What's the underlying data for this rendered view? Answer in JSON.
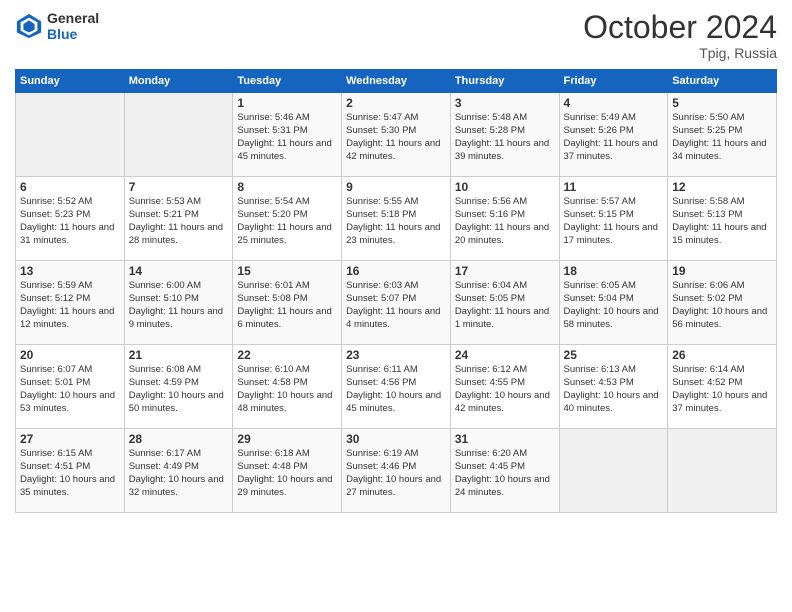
{
  "header": {
    "logo_line1": "General",
    "logo_line2": "Blue",
    "month": "October 2024",
    "location": "Tpig, Russia"
  },
  "weekdays": [
    "Sunday",
    "Monday",
    "Tuesday",
    "Wednesday",
    "Thursday",
    "Friday",
    "Saturday"
  ],
  "weeks": [
    [
      {
        "day": "",
        "sunrise": "",
        "sunset": "",
        "daylight": "",
        "empty": true
      },
      {
        "day": "",
        "sunrise": "",
        "sunset": "",
        "daylight": "",
        "empty": true
      },
      {
        "day": "1",
        "sunrise": "Sunrise: 5:46 AM",
        "sunset": "Sunset: 5:31 PM",
        "daylight": "Daylight: 11 hours and 45 minutes."
      },
      {
        "day": "2",
        "sunrise": "Sunrise: 5:47 AM",
        "sunset": "Sunset: 5:30 PM",
        "daylight": "Daylight: 11 hours and 42 minutes."
      },
      {
        "day": "3",
        "sunrise": "Sunrise: 5:48 AM",
        "sunset": "Sunset: 5:28 PM",
        "daylight": "Daylight: 11 hours and 39 minutes."
      },
      {
        "day": "4",
        "sunrise": "Sunrise: 5:49 AM",
        "sunset": "Sunset: 5:26 PM",
        "daylight": "Daylight: 11 hours and 37 minutes."
      },
      {
        "day": "5",
        "sunrise": "Sunrise: 5:50 AM",
        "sunset": "Sunset: 5:25 PM",
        "daylight": "Daylight: 11 hours and 34 minutes."
      }
    ],
    [
      {
        "day": "6",
        "sunrise": "Sunrise: 5:52 AM",
        "sunset": "Sunset: 5:23 PM",
        "daylight": "Daylight: 11 hours and 31 minutes."
      },
      {
        "day": "7",
        "sunrise": "Sunrise: 5:53 AM",
        "sunset": "Sunset: 5:21 PM",
        "daylight": "Daylight: 11 hours and 28 minutes."
      },
      {
        "day": "8",
        "sunrise": "Sunrise: 5:54 AM",
        "sunset": "Sunset: 5:20 PM",
        "daylight": "Daylight: 11 hours and 25 minutes."
      },
      {
        "day": "9",
        "sunrise": "Sunrise: 5:55 AM",
        "sunset": "Sunset: 5:18 PM",
        "daylight": "Daylight: 11 hours and 23 minutes."
      },
      {
        "day": "10",
        "sunrise": "Sunrise: 5:56 AM",
        "sunset": "Sunset: 5:16 PM",
        "daylight": "Daylight: 11 hours and 20 minutes."
      },
      {
        "day": "11",
        "sunrise": "Sunrise: 5:57 AM",
        "sunset": "Sunset: 5:15 PM",
        "daylight": "Daylight: 11 hours and 17 minutes."
      },
      {
        "day": "12",
        "sunrise": "Sunrise: 5:58 AM",
        "sunset": "Sunset: 5:13 PM",
        "daylight": "Daylight: 11 hours and 15 minutes."
      }
    ],
    [
      {
        "day": "13",
        "sunrise": "Sunrise: 5:59 AM",
        "sunset": "Sunset: 5:12 PM",
        "daylight": "Daylight: 11 hours and 12 minutes."
      },
      {
        "day": "14",
        "sunrise": "Sunrise: 6:00 AM",
        "sunset": "Sunset: 5:10 PM",
        "daylight": "Daylight: 11 hours and 9 minutes."
      },
      {
        "day": "15",
        "sunrise": "Sunrise: 6:01 AM",
        "sunset": "Sunset: 5:08 PM",
        "daylight": "Daylight: 11 hours and 6 minutes."
      },
      {
        "day": "16",
        "sunrise": "Sunrise: 6:03 AM",
        "sunset": "Sunset: 5:07 PM",
        "daylight": "Daylight: 11 hours and 4 minutes."
      },
      {
        "day": "17",
        "sunrise": "Sunrise: 6:04 AM",
        "sunset": "Sunset: 5:05 PM",
        "daylight": "Daylight: 11 hours and 1 minute."
      },
      {
        "day": "18",
        "sunrise": "Sunrise: 6:05 AM",
        "sunset": "Sunset: 5:04 PM",
        "daylight": "Daylight: 10 hours and 58 minutes."
      },
      {
        "day": "19",
        "sunrise": "Sunrise: 6:06 AM",
        "sunset": "Sunset: 5:02 PM",
        "daylight": "Daylight: 10 hours and 56 minutes."
      }
    ],
    [
      {
        "day": "20",
        "sunrise": "Sunrise: 6:07 AM",
        "sunset": "Sunset: 5:01 PM",
        "daylight": "Daylight: 10 hours and 53 minutes."
      },
      {
        "day": "21",
        "sunrise": "Sunrise: 6:08 AM",
        "sunset": "Sunset: 4:59 PM",
        "daylight": "Daylight: 10 hours and 50 minutes."
      },
      {
        "day": "22",
        "sunrise": "Sunrise: 6:10 AM",
        "sunset": "Sunset: 4:58 PM",
        "daylight": "Daylight: 10 hours and 48 minutes."
      },
      {
        "day": "23",
        "sunrise": "Sunrise: 6:11 AM",
        "sunset": "Sunset: 4:56 PM",
        "daylight": "Daylight: 10 hours and 45 minutes."
      },
      {
        "day": "24",
        "sunrise": "Sunrise: 6:12 AM",
        "sunset": "Sunset: 4:55 PM",
        "daylight": "Daylight: 10 hours and 42 minutes."
      },
      {
        "day": "25",
        "sunrise": "Sunrise: 6:13 AM",
        "sunset": "Sunset: 4:53 PM",
        "daylight": "Daylight: 10 hours and 40 minutes."
      },
      {
        "day": "26",
        "sunrise": "Sunrise: 6:14 AM",
        "sunset": "Sunset: 4:52 PM",
        "daylight": "Daylight: 10 hours and 37 minutes."
      }
    ],
    [
      {
        "day": "27",
        "sunrise": "Sunrise: 6:15 AM",
        "sunset": "Sunset: 4:51 PM",
        "daylight": "Daylight: 10 hours and 35 minutes."
      },
      {
        "day": "28",
        "sunrise": "Sunrise: 6:17 AM",
        "sunset": "Sunset: 4:49 PM",
        "daylight": "Daylight: 10 hours and 32 minutes."
      },
      {
        "day": "29",
        "sunrise": "Sunrise: 6:18 AM",
        "sunset": "Sunset: 4:48 PM",
        "daylight": "Daylight: 10 hours and 29 minutes."
      },
      {
        "day": "30",
        "sunrise": "Sunrise: 6:19 AM",
        "sunset": "Sunset: 4:46 PM",
        "daylight": "Daylight: 10 hours and 27 minutes."
      },
      {
        "day": "31",
        "sunrise": "Sunrise: 6:20 AM",
        "sunset": "Sunset: 4:45 PM",
        "daylight": "Daylight: 10 hours and 24 minutes."
      },
      {
        "day": "",
        "sunrise": "",
        "sunset": "",
        "daylight": "",
        "empty": true
      },
      {
        "day": "",
        "sunrise": "",
        "sunset": "",
        "daylight": "",
        "empty": true
      }
    ]
  ]
}
